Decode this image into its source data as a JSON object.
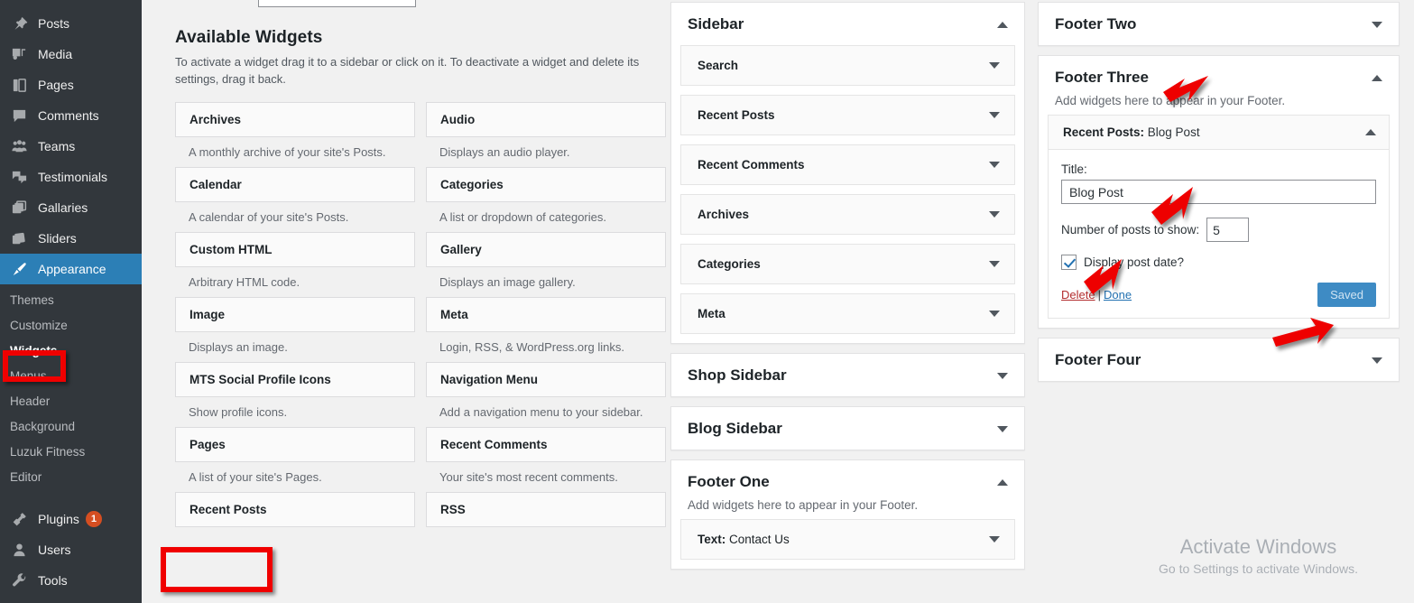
{
  "sidebar": {
    "items": [
      {
        "label": "Posts",
        "icon": "pin-icon"
      },
      {
        "label": "Media",
        "icon": "media-icon"
      },
      {
        "label": "Pages",
        "icon": "pages-icon"
      },
      {
        "label": "Comments",
        "icon": "comment-icon"
      },
      {
        "label": "Teams",
        "icon": "teams-icon"
      },
      {
        "label": "Testimonials",
        "icon": "testimonials-icon"
      },
      {
        "label": "Gallaries",
        "icon": "gallery-icon"
      },
      {
        "label": "Sliders",
        "icon": "sliders-icon"
      },
      {
        "label": "Appearance",
        "icon": "appearance-brush-icon"
      }
    ],
    "submenu": [
      "Themes",
      "Customize",
      "Widgets",
      "Menus",
      "Header",
      "Background",
      "Luzuk Fitness",
      "Editor"
    ],
    "bottom_items": [
      {
        "label": "Plugins",
        "icon": "plug-icon",
        "badge": "1"
      },
      {
        "label": "Users",
        "icon": "user-icon",
        "badge": ""
      },
      {
        "label": "Tools",
        "icon": "wrench-icon",
        "badge": ""
      }
    ]
  },
  "available": {
    "title": "Available Widgets",
    "description": "To activate a widget drag it to a sidebar or click on it. To deactivate a widget and delete its settings, drag it back.",
    "widgets": [
      {
        "name": "Archives",
        "desc": "A monthly archive of your site's Posts."
      },
      {
        "name": "Audio",
        "desc": "Displays an audio player."
      },
      {
        "name": "Calendar",
        "desc": "A calendar of your site's Posts."
      },
      {
        "name": "Categories",
        "desc": "A list or dropdown of categories."
      },
      {
        "name": "Custom HTML",
        "desc": "Arbitrary HTML code."
      },
      {
        "name": "Gallery",
        "desc": "Displays an image gallery."
      },
      {
        "name": "Image",
        "desc": "Displays an image."
      },
      {
        "name": "Meta",
        "desc": "Login, RSS, & WordPress.org links."
      },
      {
        "name": "MTS Social Profile Icons",
        "desc": "Show profile icons."
      },
      {
        "name": "Navigation Menu",
        "desc": "Add a navigation menu to your sidebar."
      },
      {
        "name": "Pages",
        "desc": "A list of your site's Pages."
      },
      {
        "name": "Recent Comments",
        "desc": "Your site's most recent comments."
      },
      {
        "name": "Recent Posts",
        "desc": ""
      },
      {
        "name": "RSS",
        "desc": ""
      }
    ]
  },
  "sidebars_column": {
    "sidebar_panel": {
      "title": "Sidebar",
      "expanded": true,
      "widgets": [
        "Search",
        "Recent Posts",
        "Recent Comments",
        "Archives",
        "Categories",
        "Meta"
      ]
    },
    "shop_sidebar": {
      "title": "Shop Sidebar",
      "expanded": false
    },
    "blog_sidebar": {
      "title": "Blog Sidebar",
      "expanded": false
    },
    "footer_one": {
      "title": "Footer One",
      "description": "Add widgets here to appear in your Footer.",
      "expanded": true,
      "widget_prefix": "Text:",
      "widget_name": " Contact Us"
    }
  },
  "footers_column": {
    "footer_two": {
      "title": "Footer Two",
      "expanded": false
    },
    "footer_three": {
      "title": "Footer Three",
      "description": "Add widgets here to appear in your Footer.",
      "expanded": true,
      "widget": {
        "head_prefix": "Recent Posts:",
        "head_name": " Blog Post",
        "title_label": "Title:",
        "title_value": "Blog Post",
        "count_label": "Number of posts to show:",
        "count_value": "5",
        "checkbox_label": "Display post date?",
        "checkbox_checked": true,
        "delete_label": "Delete",
        "separator": "|",
        "done_label": "Done",
        "save_label": "Saved"
      }
    },
    "footer_four": {
      "title": "Footer Four",
      "expanded": false
    }
  },
  "watermark": {
    "line1": "Activate Windows",
    "line2": "Go to Settings to activate Windows."
  },
  "colors": {
    "accent_blue": "#2c7fb6",
    "sidebar_bg": "#32373c",
    "page_bg": "#f1f1f1",
    "annotation_red": "#f00000",
    "badge_orange": "#d54e21"
  }
}
